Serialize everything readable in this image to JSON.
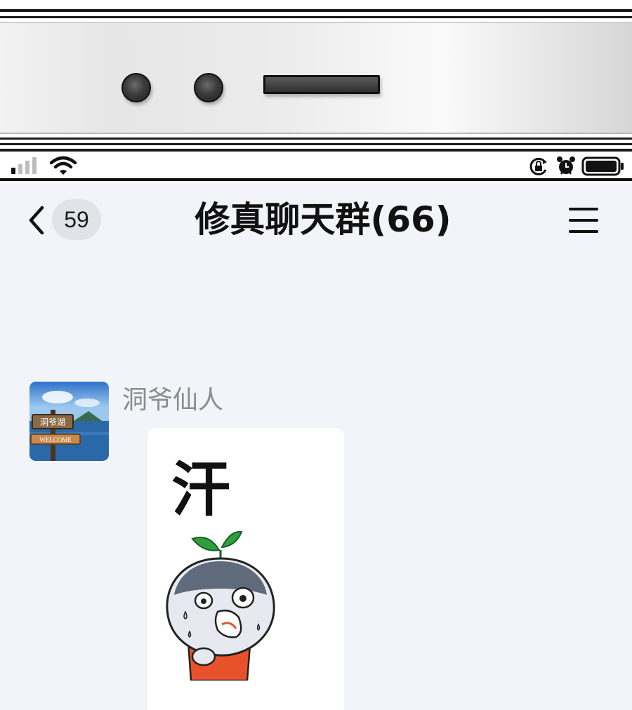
{
  "status_bar": {
    "icons": [
      "cellular-signal-icon",
      "wifi-icon",
      "rotation-lock-icon",
      "alarm-clock-icon",
      "battery-icon"
    ]
  },
  "nav": {
    "back_icon": "chevron-left-icon",
    "unread_count": "59",
    "title": "修真聊天群(66)",
    "menu_icon": "hamburger-menu-icon"
  },
  "messages": [
    {
      "sender": "洞爷仙人",
      "avatar_sign_text": "洞爷湖",
      "avatar_welcome_text": "WELCOME",
      "sticker_text": "汗"
    }
  ],
  "colors": {
    "screen_background": "#f3f4f9",
    "badge_background": "#e2e3e8",
    "sender_name": "#8c8c8c",
    "bubble": "#ffffff",
    "sticker_leaf": "#2e9e3e",
    "sticker_shirt": "#e8522b"
  }
}
